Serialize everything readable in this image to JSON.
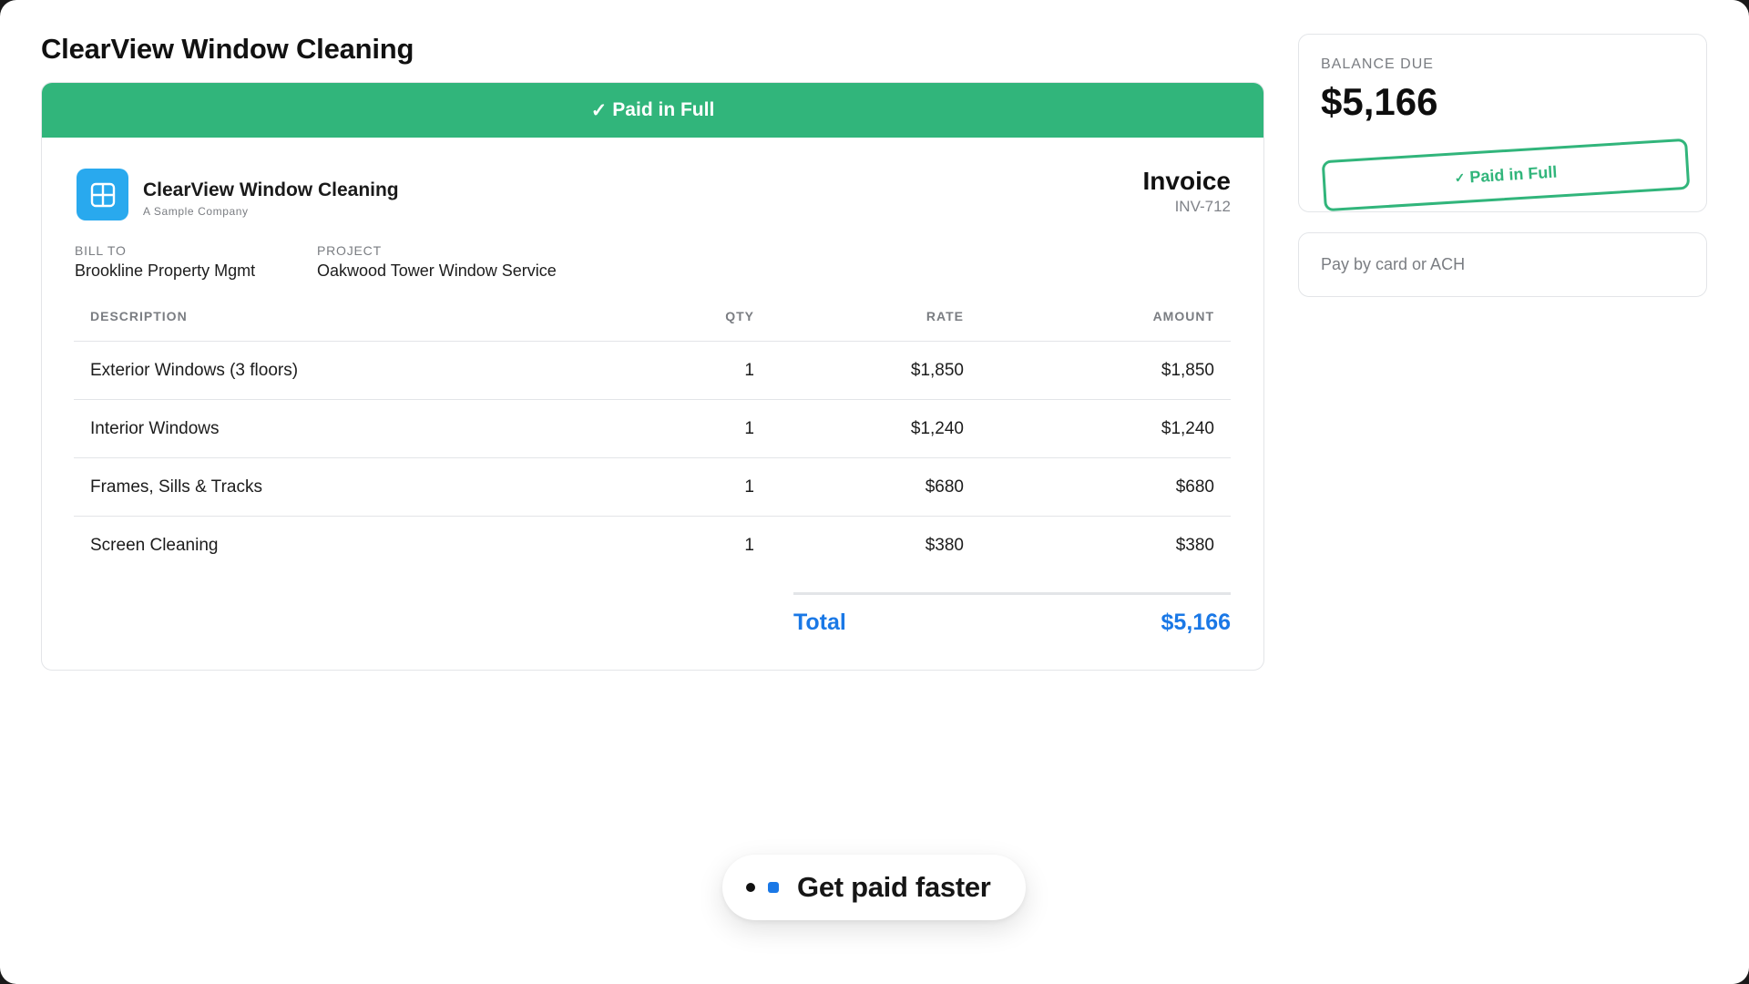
{
  "page": {
    "title": "ClearView Window Cleaning"
  },
  "invoice": {
    "banner": {
      "check": "✓",
      "text": "Paid in Full"
    },
    "company": {
      "name": "ClearView Window Cleaning",
      "subtitle": "A Sample Company",
      "logo_icon": "grid-window-icon"
    },
    "label": "Invoice",
    "number": "INV-712",
    "bill_to": {
      "label": "BILL TO",
      "value": "Brookline Property Mgmt"
    },
    "project": {
      "label": "PROJECT",
      "value": "Oakwood Tower Window Service"
    },
    "columns": {
      "description": "DESCRIPTION",
      "qty": "QTY",
      "rate": "RATE",
      "amount": "AMOUNT"
    },
    "items": [
      {
        "description": "Exterior Windows (3 floors)",
        "qty": "1",
        "rate": "$1,850",
        "amount": "$1,850"
      },
      {
        "description": "Interior Windows",
        "qty": "1",
        "rate": "$1,240",
        "amount": "$1,240"
      },
      {
        "description": "Frames, Sills & Tracks",
        "qty": "1",
        "rate": "$680",
        "amount": "$680"
      },
      {
        "description": "Screen Cleaning",
        "qty": "1",
        "rate": "$380",
        "amount": "$380"
      }
    ],
    "total": {
      "label": "Total",
      "value": "$5,166"
    }
  },
  "sidebar": {
    "balance": {
      "label": "BALANCE DUE",
      "amount": "$5,166"
    },
    "stamp": {
      "check": "✓",
      "text": "Paid in Full"
    },
    "pay": {
      "label": "Pay by card or ACH"
    }
  },
  "pill": {
    "text": "Get paid faster"
  },
  "colors": {
    "accent_green": "#31b57b",
    "accent_blue": "#1a78e6",
    "logo_blue": "#29a9ee"
  }
}
